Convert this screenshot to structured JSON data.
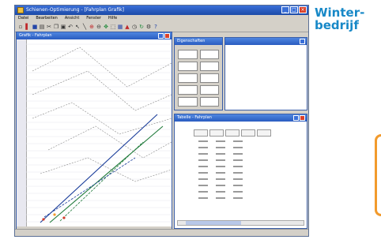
{
  "app": {
    "title": "Schienen-Optimierung - [Fahrplan Grafik]"
  },
  "menu": [
    "Datei",
    "Bearbeiten",
    "Ansicht",
    "Fenster",
    "Hilfe"
  ],
  "toolbar_icons": [
    "new-icon",
    "open-icon",
    "save-icon",
    "print-icon",
    "cut-icon",
    "copy-icon",
    "paste-icon",
    "undo-icon",
    "arrow-icon",
    "line-icon",
    "zoom-in-icon",
    "zoom-out-icon",
    "move-icon",
    "select-icon",
    "grid-icon",
    "train-icon",
    "clock-icon",
    "refresh-icon",
    "settings-icon",
    "help-icon"
  ],
  "graph_window": {
    "title": "Grafik - Fahrplan",
    "status": ""
  },
  "panel_small": {
    "title": "Eigenschaften",
    "cells": [
      "",
      "",
      "",
      "",
      "",
      "",
      "",
      "",
      "",
      ""
    ]
  },
  "panel_right": {
    "title": ""
  },
  "table_window": {
    "title": "Tabelle - Fahrplan",
    "label": "",
    "columns": [
      "",
      "",
      "",
      "",
      ""
    ],
    "notes": [
      "",
      ""
    ]
  },
  "heading": {
    "line1": "Winter-",
    "line2": "bedrijf"
  },
  "colors": {
    "accent": "#1788c7",
    "orange": "#f29a2c",
    "title_blue": "#2a5cc0"
  }
}
